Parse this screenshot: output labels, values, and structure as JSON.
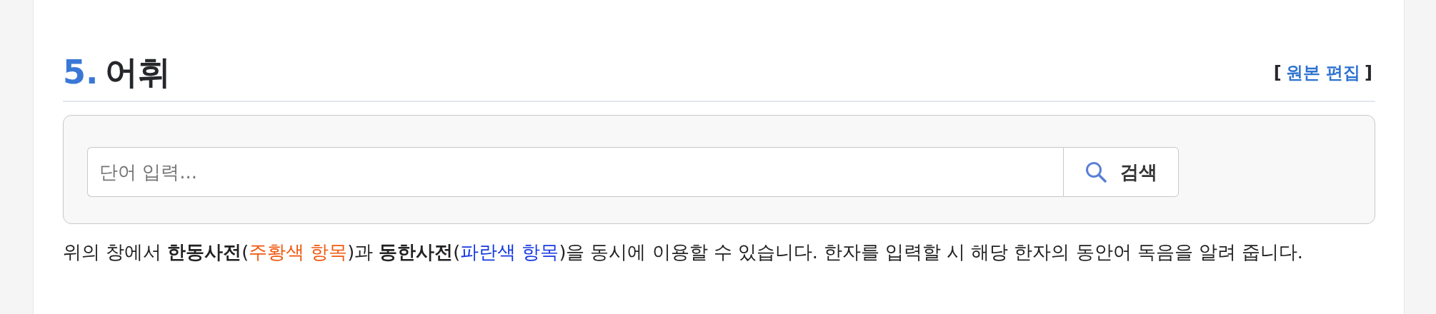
{
  "section": {
    "number": "5.",
    "title": "어휘",
    "edit_link": {
      "open": "[",
      "label": "원본 편집",
      "close": "]"
    }
  },
  "search": {
    "placeholder": "단어 입력...",
    "button": "검색"
  },
  "description": [
    {
      "kind": "plain",
      "text": "위의 창에서 "
    },
    {
      "kind": "bold",
      "text": "한동사전"
    },
    {
      "kind": "plain",
      "text": "("
    },
    {
      "kind": "colored",
      "text": "주황색 항목",
      "color": "#f0590f"
    },
    {
      "kind": "plain",
      "text": ")과 "
    },
    {
      "kind": "bold",
      "text": "동한사전"
    },
    {
      "kind": "plain",
      "text": "("
    },
    {
      "kind": "colored",
      "text": "파란색 항목",
      "color": "#1438e0"
    },
    {
      "kind": "plain",
      "text": ")을 동시에 이용할 수 있습니다. 한자를 입력할 시 해당 한자의 동안어 독음을 알려 줍니다."
    }
  ]
}
